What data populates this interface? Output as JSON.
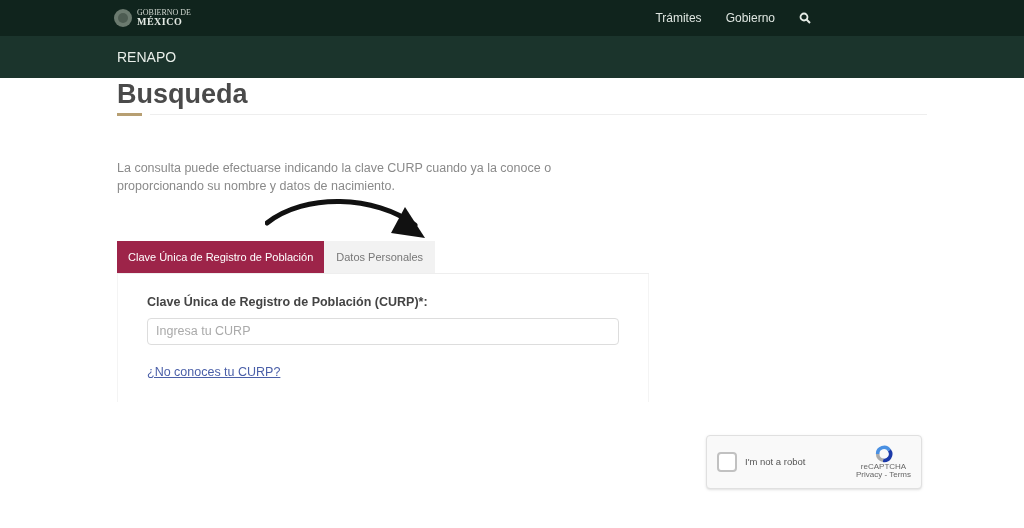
{
  "header": {
    "logo_small": "GOBIERNO DE",
    "logo_big": "MÉXICO",
    "nav": [
      "Trámites",
      "Gobierno"
    ]
  },
  "subheader": {
    "title": "RENAPO"
  },
  "page": {
    "heading": "Busqueda",
    "intro": "La consulta puede efectuarse indicando la clave CURP cuando ya la conoce o proporcionando su nombre y datos de nacimiento."
  },
  "tabs": [
    {
      "label": "Clave Única de Registro de Población",
      "selected": true
    },
    {
      "label": "Datos Personales",
      "selected": false
    }
  ],
  "form": {
    "label": "Clave Única de Registro de Población (CURP)*:",
    "placeholder": "Ingresa tu CURP",
    "link": "¿No conoces tu CURP?"
  },
  "captcha": {
    "label": "I'm not a robot",
    "checked": false,
    "brand": "reCAPTCHA",
    "links": "Privacy - Terms"
  }
}
